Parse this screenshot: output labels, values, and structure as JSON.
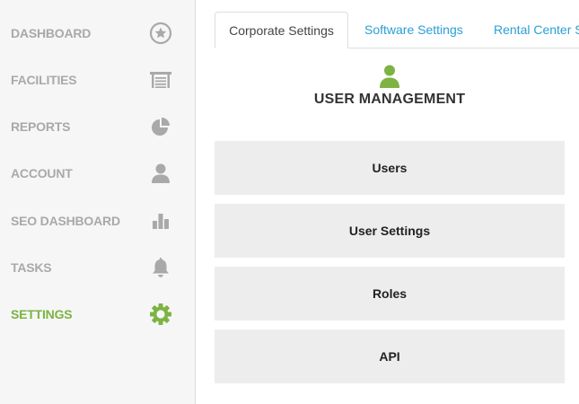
{
  "sidebar": {
    "items": [
      {
        "label": "DASHBOARD",
        "icon": "star-icon"
      },
      {
        "label": "FACILITIES",
        "icon": "facility-icon"
      },
      {
        "label": "REPORTS",
        "icon": "pie-chart-icon"
      },
      {
        "label": "ACCOUNT",
        "icon": "user-icon"
      },
      {
        "label": "SEO DASHBOARD",
        "icon": "bar-chart-icon"
      },
      {
        "label": "TASKS",
        "icon": "bell-icon"
      },
      {
        "label": "SETTINGS",
        "icon": "gear-icon",
        "active": true
      }
    ]
  },
  "tabs": [
    {
      "label": "Corporate Settings",
      "active": true
    },
    {
      "label": "Software Settings"
    },
    {
      "label": "Rental Center S"
    }
  ],
  "section": {
    "title": "USER MANAGEMENT",
    "icon": "user-icon"
  },
  "buttons": [
    {
      "label": "Users"
    },
    {
      "label": "User Settings"
    },
    {
      "label": "Roles"
    },
    {
      "label": "API"
    }
  ],
  "colors": {
    "active": "#7cb342",
    "inactive": "#a9a9a9",
    "link": "#2a9fd6",
    "button_bg": "#ededed"
  }
}
